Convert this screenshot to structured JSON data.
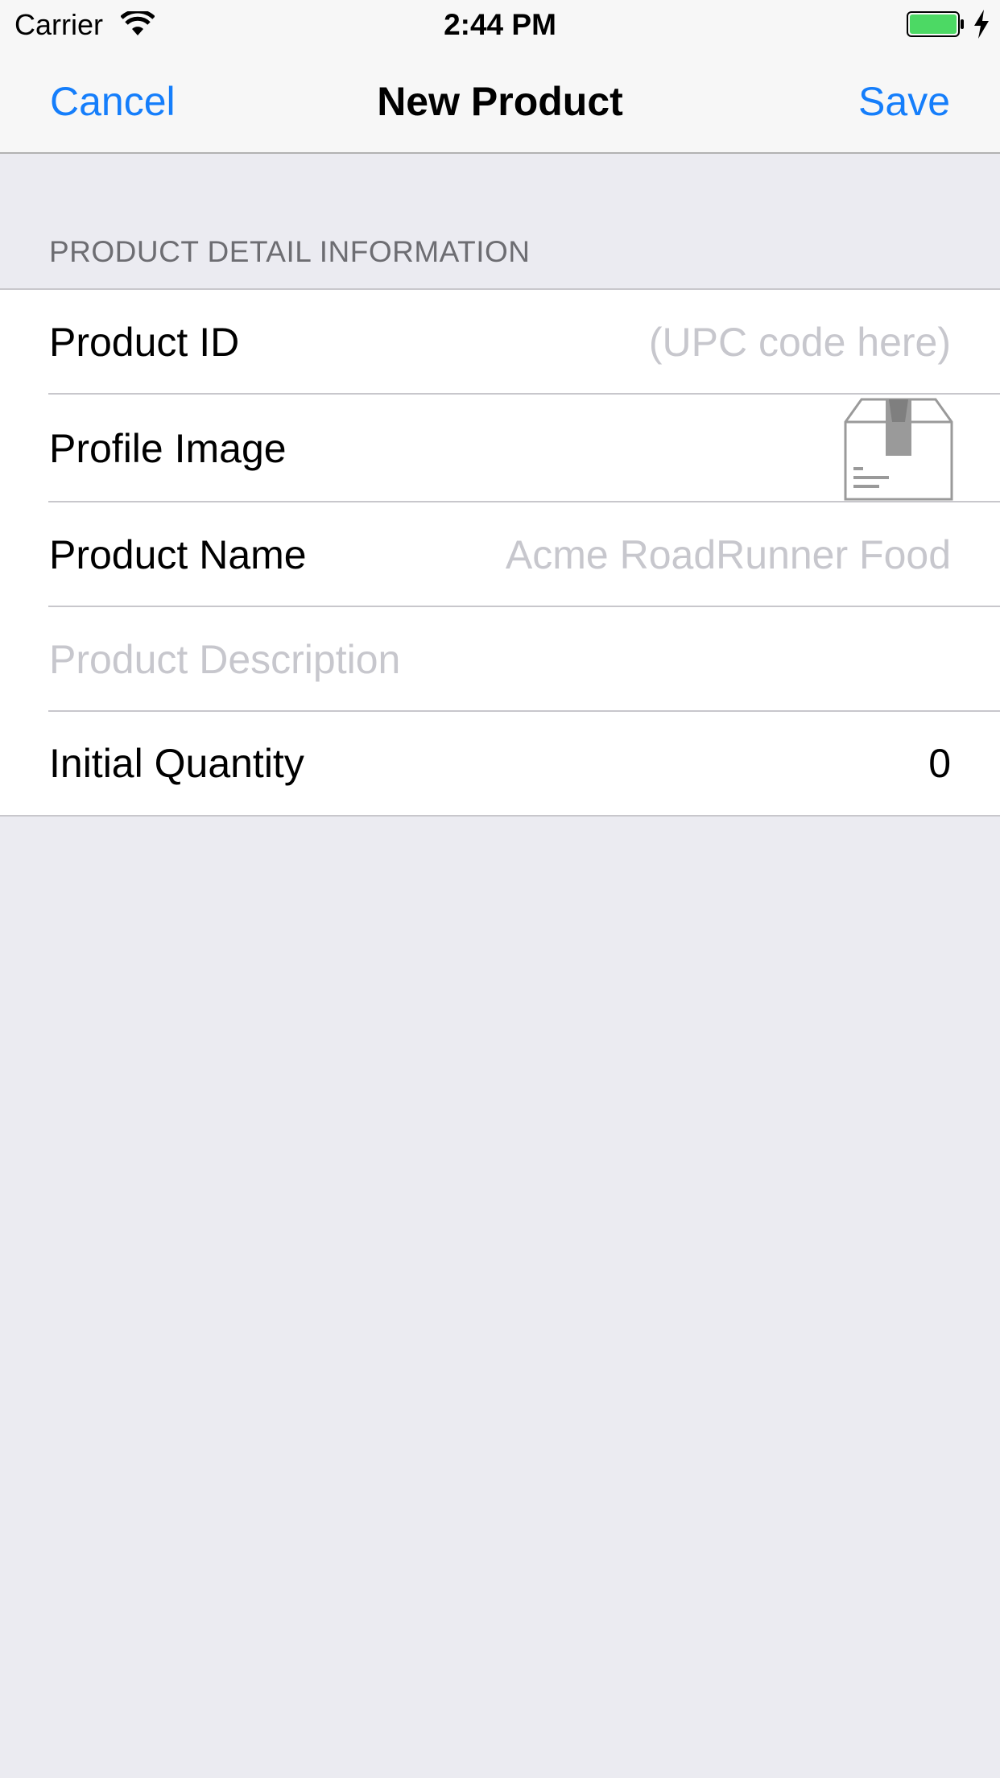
{
  "status_bar": {
    "carrier": "Carrier",
    "time": "2:44 PM",
    "battery_color": "#4cd964"
  },
  "nav": {
    "cancel_label": "Cancel",
    "title": "New Product",
    "save_label": "Save",
    "tint_color": "#157efb"
  },
  "section": {
    "header": "PRODUCT DETAIL INFORMATION"
  },
  "rows": [
    {
      "label": "Product ID",
      "placeholder": "(UPC code here)"
    },
    {
      "label": "Profile Image",
      "icon": "product-box-icon"
    },
    {
      "label": "Product Name",
      "placeholder": "Acme RoadRunner Food"
    },
    {
      "placeholder": "Product Description"
    },
    {
      "label": "Initial Quantity",
      "value": "0"
    }
  ]
}
